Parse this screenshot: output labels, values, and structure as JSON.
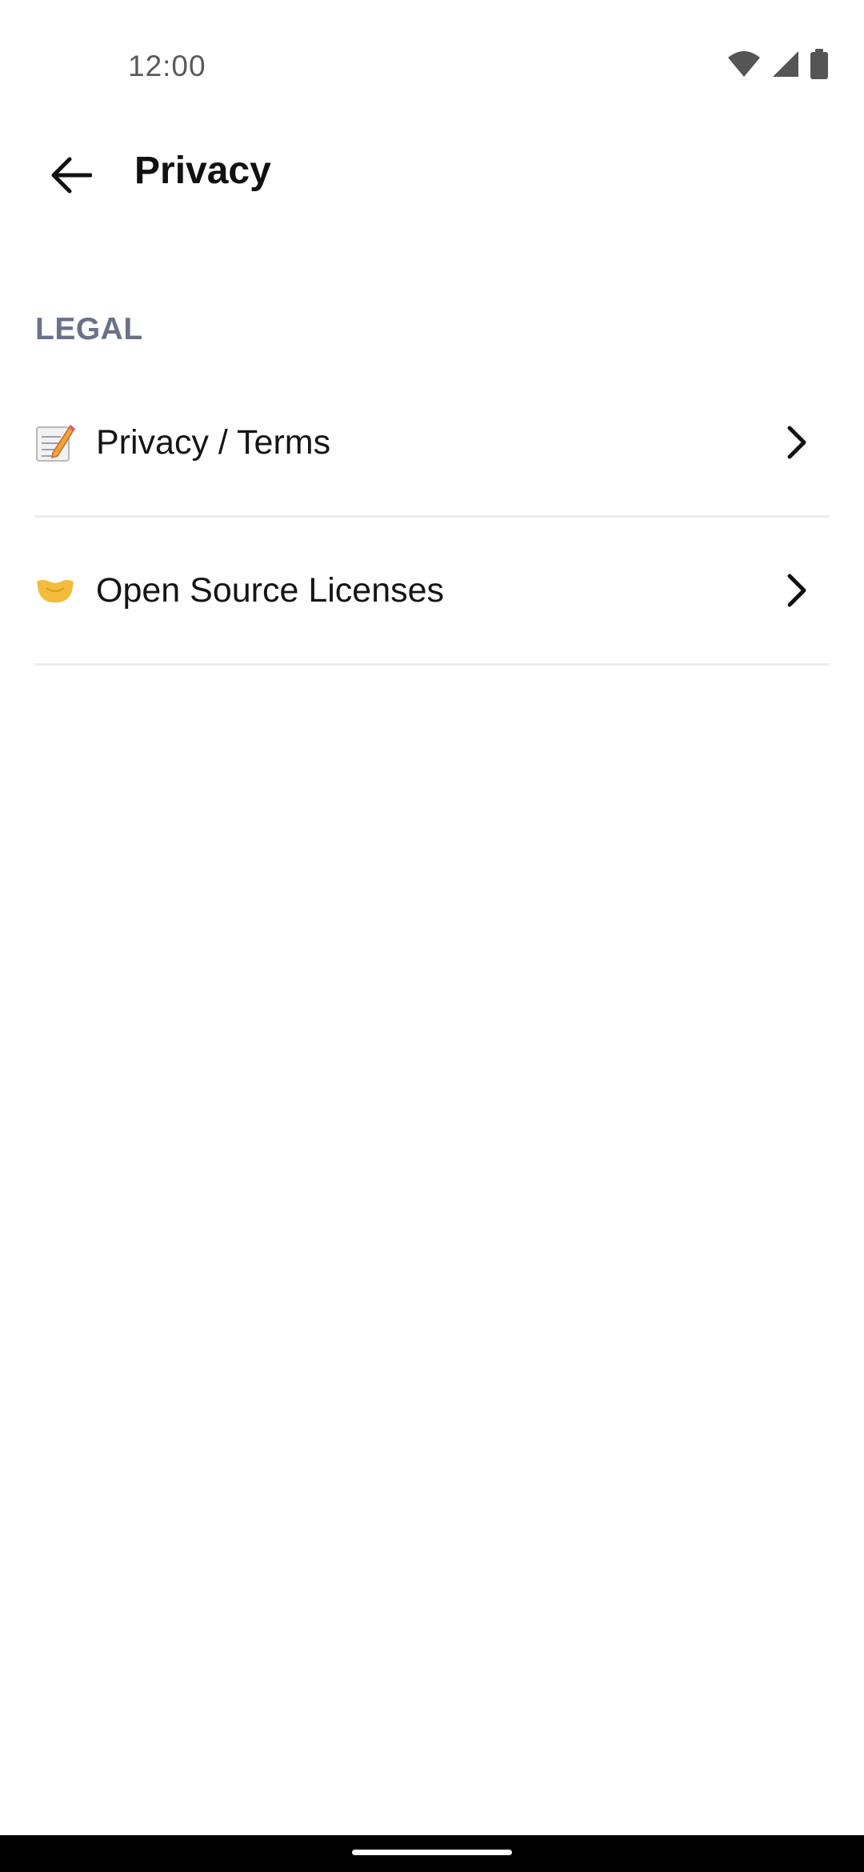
{
  "status_bar": {
    "time": "12:00",
    "icons": [
      "wifi-icon",
      "cellular-signal-icon",
      "battery-icon"
    ]
  },
  "app_bar": {
    "title": "Privacy",
    "back_icon": "arrow-left-icon"
  },
  "sections": [
    {
      "header": "LEGAL",
      "items": [
        {
          "label": "Privacy / Terms",
          "icon": "memo-emoji-icon"
        },
        {
          "label": "Open Source Licenses",
          "icon": "handshake-emoji-icon"
        }
      ]
    }
  ],
  "colors": {
    "section_header": "#6b7288",
    "divider": "#ececef",
    "text": "#151515",
    "nav_bar": "#000000"
  }
}
